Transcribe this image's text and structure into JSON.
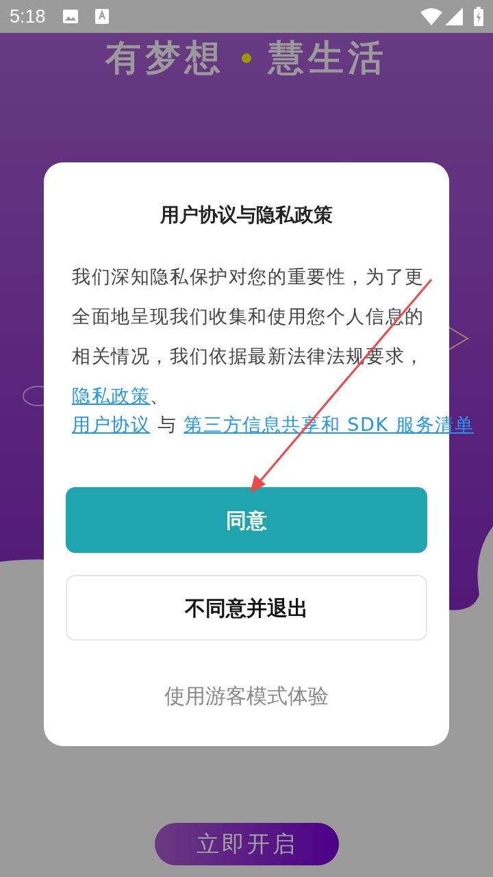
{
  "status_bar": {
    "time": "5:18"
  },
  "background": {
    "slogan": [
      "有梦想",
      "慧生活"
    ],
    "start_button": "立即开启"
  },
  "dialog": {
    "title": "用户协议与隐私政策",
    "message": "我们深知隐私保护对您的重要性，为了更全面地呈现我们收集和使用您个人信息的相关情况，我们依据最新法律法规要求，",
    "links": [
      {
        "kind": "link",
        "text": "隐私政策"
      },
      {
        "kind": "text",
        "text": "、"
      },
      {
        "kind": "link",
        "text": "用户协议"
      },
      {
        "kind": "text",
        "text": " 与 "
      },
      {
        "kind": "link",
        "text": "第三方信息共享和 SDK 服务清单"
      }
    ],
    "agree_button": "同意",
    "decline_button": "不同意并退出",
    "guest_link": "使用游客模式体验"
  }
}
